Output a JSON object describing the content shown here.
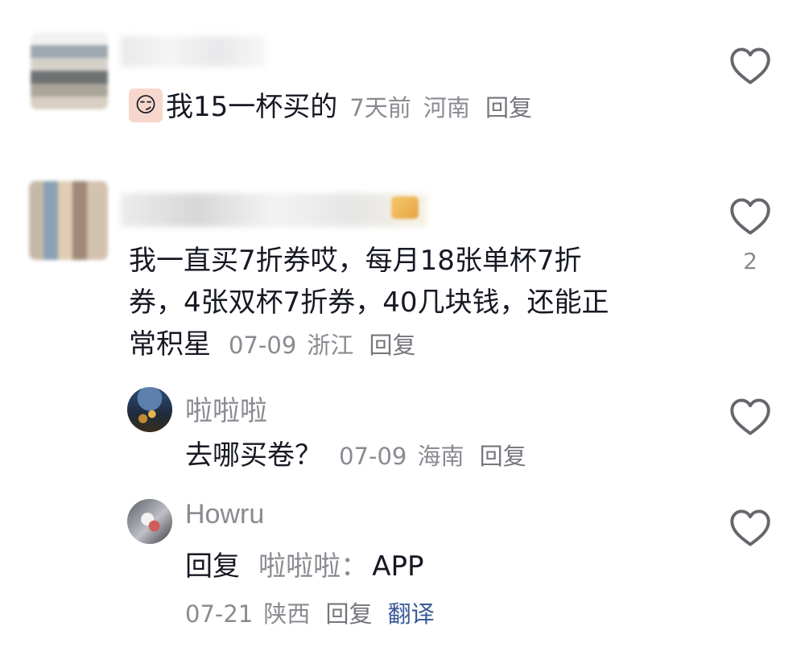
{
  "comments": [
    {
      "text": "我15一杯买的",
      "time": "7天前",
      "location": "河南",
      "reply": "回复",
      "sticker": "face-sticker-icon"
    },
    {
      "text": "我一直买7折券哎，每月18张单杯7折\n券，4张双杯7折券，40几块钱，还能正\n常积星",
      "time": "07-09",
      "location": "浙江",
      "reply": "回复",
      "likes": "2",
      "replies": [
        {
          "username": "啦啦啦",
          "text": "去哪买卷？",
          "time": "07-09",
          "location": "海南",
          "reply": "回复"
        },
        {
          "username": "Howru",
          "reply_prefix": "回复",
          "reply_to": "啦啦啦：",
          "text": "APP",
          "time": "07-21",
          "location": "陕西",
          "reply": "回复",
          "translate": "翻译"
        }
      ]
    }
  ],
  "colors": {
    "primary_text": "#161823",
    "meta_text": "#8a8b91",
    "translate_link": "#3b5998",
    "heart_icon": "#66666d"
  }
}
